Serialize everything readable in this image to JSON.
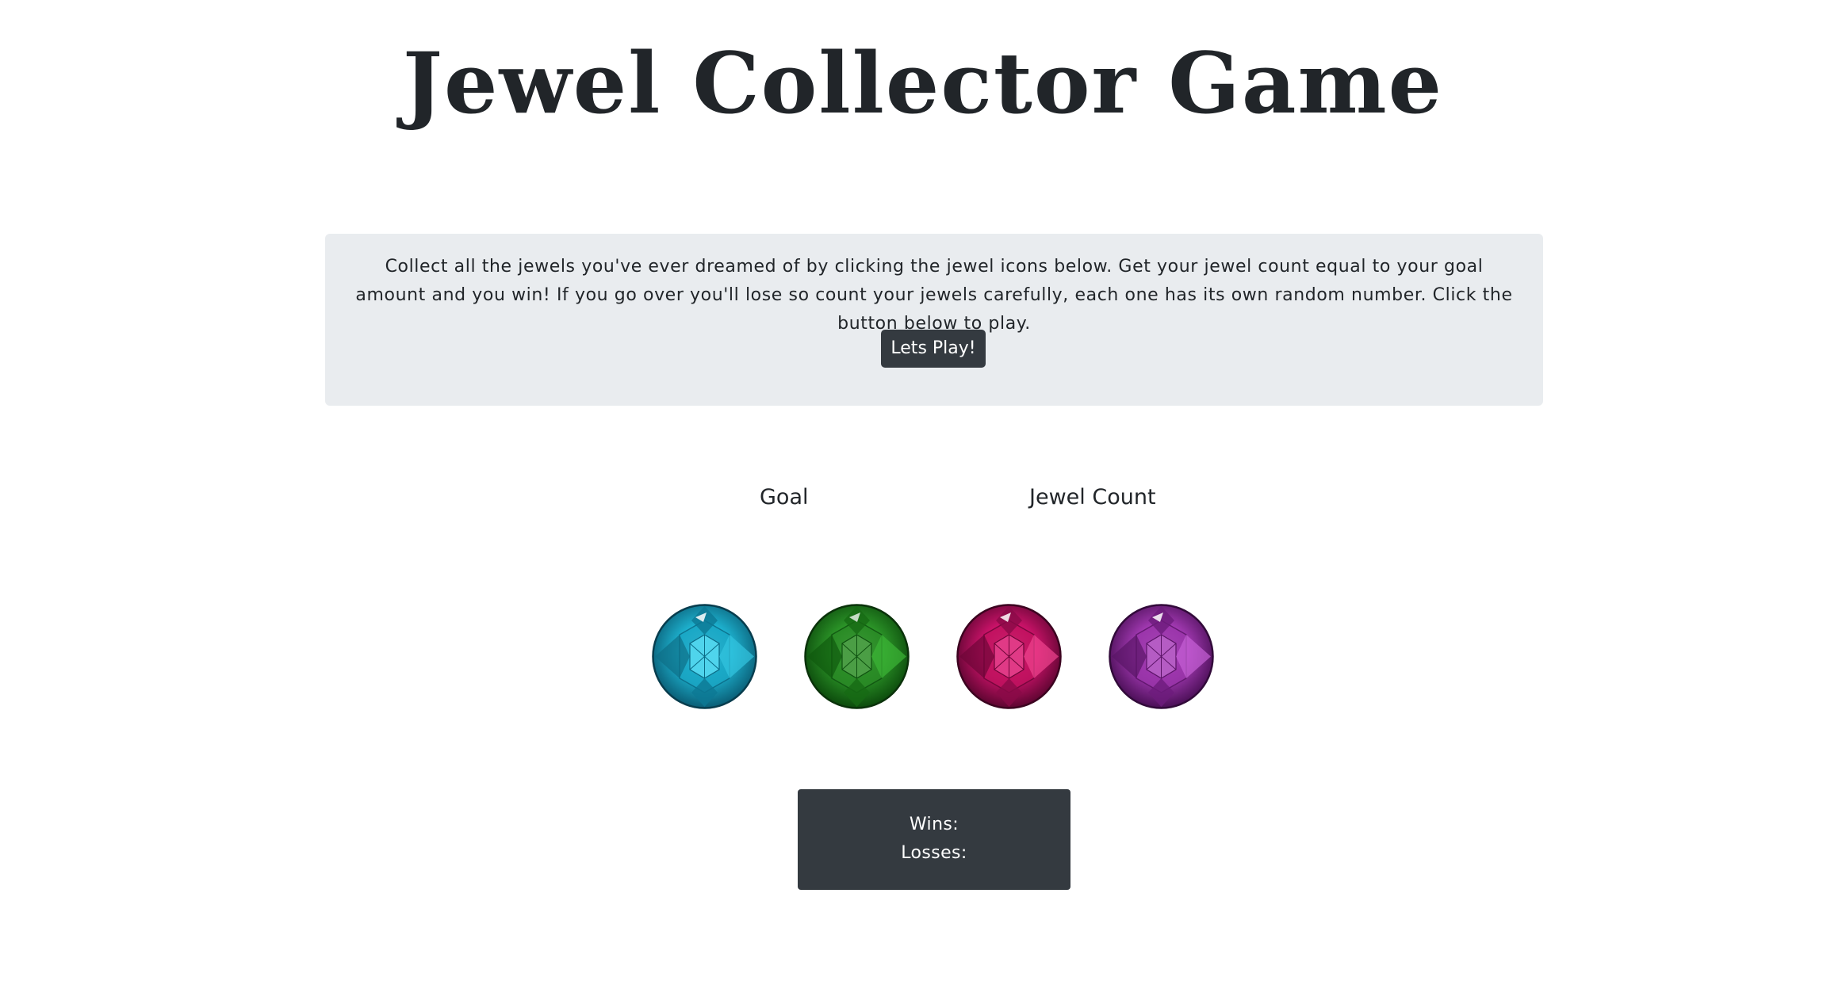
{
  "page": {
    "title": "Jewel Collector Game"
  },
  "intro": {
    "text": "Collect all the jewels you've ever dreamed of by clicking the jewel icons below. Get your jewel count equal to your goal amount and you win! If you go over you'll lose so count your jewels carefully, each one has its own random number. Click the button below to play.",
    "play_button_label": "Lets Play!"
  },
  "stats": {
    "goal_label": "Goal",
    "goal_value": "",
    "jewel_count_label": "Jewel Count",
    "jewel_count_value": ""
  },
  "jewels": [
    {
      "name": "blue-jewel-icon",
      "color": "#1fb8d6"
    },
    {
      "name": "green-jewel-icon",
      "color": "#2e9a2a"
    },
    {
      "name": "pink-jewel-icon",
      "color": "#d4146e"
    },
    {
      "name": "purple-jewel-icon",
      "color": "#a83cb8"
    }
  ],
  "scoreboard": {
    "wins_label": "Wins:",
    "losses_label": "Losses:"
  },
  "colors": {
    "dark": "#343a40",
    "panel": "#e9ecef",
    "text": "#212529"
  }
}
